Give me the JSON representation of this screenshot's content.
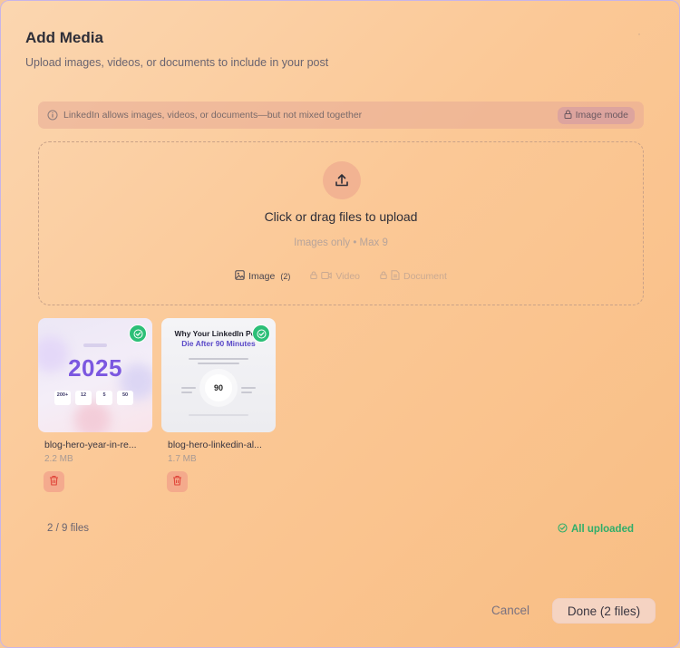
{
  "dialog": {
    "title": "Add Media",
    "subtitle": "Upload images, videos, or documents to include in your post",
    "close_icon": "close-icon"
  },
  "notice": {
    "text": "LinkedIn allows images, videos, or documents—but not mixed together",
    "mode_label": "Image mode",
    "icon": "info-icon"
  },
  "dropzone": {
    "title": "Click or drag files to upload",
    "hint": "Images only • Max 9",
    "types": [
      {
        "label": "Image",
        "count": "(2)",
        "icon": "image-icon",
        "state": "active"
      },
      {
        "label": "Video",
        "icon": "video-icon",
        "state": "disabled"
      },
      {
        "label": "Document",
        "icon": "document-icon",
        "state": "disabled"
      }
    ]
  },
  "files": [
    {
      "name": "blog-hero-year-in-re...",
      "size": "2.2 MB",
      "thumb_text": {
        "year": "2025",
        "stats": [
          "200+",
          "12",
          "5",
          "50"
        ]
      }
    },
    {
      "name": "blog-hero-linkedin-al...",
      "size": "1.7 MB",
      "thumb_text": {
        "title": "Why Your LinkedIn Post",
        "subtitle": "Die After 90 Minutes",
        "center": "90"
      }
    }
  ],
  "footer": {
    "file_count": "2 / 9 files",
    "status": "All uploaded",
    "cancel_label": "Cancel",
    "done_label": "Done (2 files)"
  },
  "colors": {
    "accent_purple": "#7b57e0",
    "success_green": "#2cbf77",
    "delete_red": "#e0453a"
  }
}
